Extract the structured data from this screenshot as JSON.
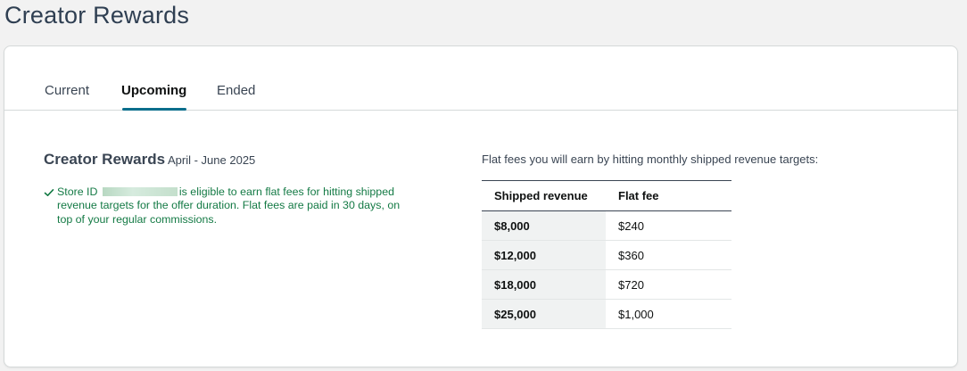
{
  "page": {
    "title": "Creator Rewards"
  },
  "tabs": [
    {
      "label": "Current",
      "active": false
    },
    {
      "label": "Upcoming",
      "active": true
    },
    {
      "label": "Ended",
      "active": false
    }
  ],
  "offer": {
    "title": "Creator Rewards",
    "dates": "April - June 2025",
    "eligibility_prefix": "Store ID",
    "eligibility_text": "is eligible to earn flat fees for hitting shipped revenue targets for the offer duration. Flat fees are paid in 30 days, on top of your regular commissions."
  },
  "fees_table": {
    "intro": "Flat fees you will earn by hitting monthly shipped revenue targets:",
    "columns": [
      "Shipped revenue",
      "Flat fee"
    ],
    "rows": [
      {
        "revenue": "$8,000",
        "fee": "$240"
      },
      {
        "revenue": "$12,000",
        "fee": "$360"
      },
      {
        "revenue": "$18,000",
        "fee": "$720"
      },
      {
        "revenue": "$25,000",
        "fee": "$1,000"
      }
    ]
  },
  "colors": {
    "accent": "#0a6e8c",
    "success_text": "#147a45"
  },
  "icons": {
    "eligibility": "check-icon"
  }
}
